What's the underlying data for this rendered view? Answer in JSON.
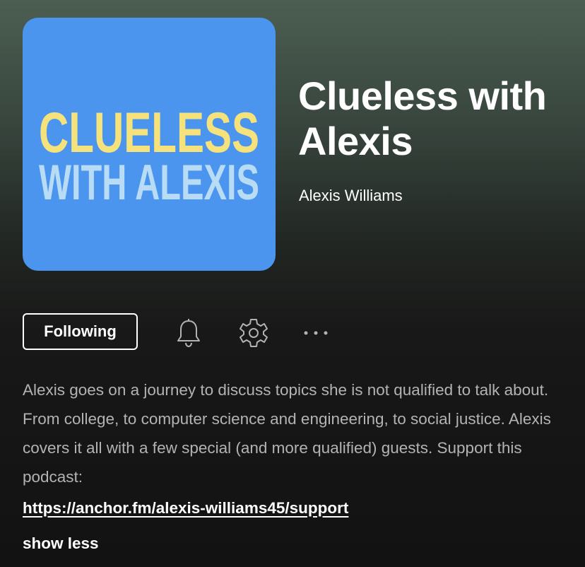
{
  "podcast": {
    "title": "Clueless with Alexis",
    "author": "Alexis Williams",
    "cover": {
      "line1": "CLUELESS",
      "line2": "WITH ALEXIS",
      "background_color": "#4b95ef",
      "line1_color": "#f6e27a",
      "line2_color": "#b9dcf6"
    }
  },
  "actions": {
    "follow_label": "Following",
    "notification_icon": "bell-icon",
    "settings_icon": "gear-icon",
    "more_icon": "more-horizontal-icon"
  },
  "description": {
    "text": "Alexis goes on a journey to discuss topics she is not qualified to talk about. From college, to computer science and engineering, to social justice. Alexis covers it all with a few special (and more qualified) guests. Support this podcast:",
    "link": "https://anchor.fm/alexis-williams45/support",
    "toggle_label": "show less"
  }
}
